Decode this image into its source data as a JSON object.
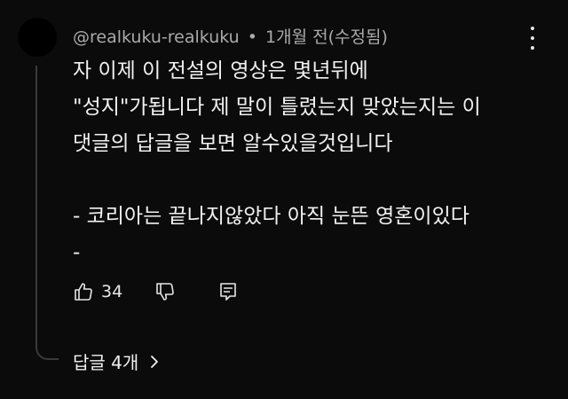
{
  "comment": {
    "author": "@realkuku-realkuku",
    "separator": "•",
    "time": "1개월 전(수정됨)",
    "lines": [
      "자 이제 이 전설의 영상은 몇년뒤에",
      "\"성지\"가됩니다 제 말이 틀렸는지 맞았는지는 이",
      "댓글의 답글을 보면 알수있을것입니다",
      "",
      "- 코리아는 끝나지않았다 아직 눈뜬 영혼이있다",
      "-"
    ],
    "likes": "34",
    "replies_label": "답글 4개"
  },
  "icons": {
    "menu": "more-vert-icon",
    "like": "thumb-up-icon",
    "dislike": "thumb-down-icon",
    "reply": "reply-comment-icon",
    "chevron": "chevron-right-icon"
  }
}
